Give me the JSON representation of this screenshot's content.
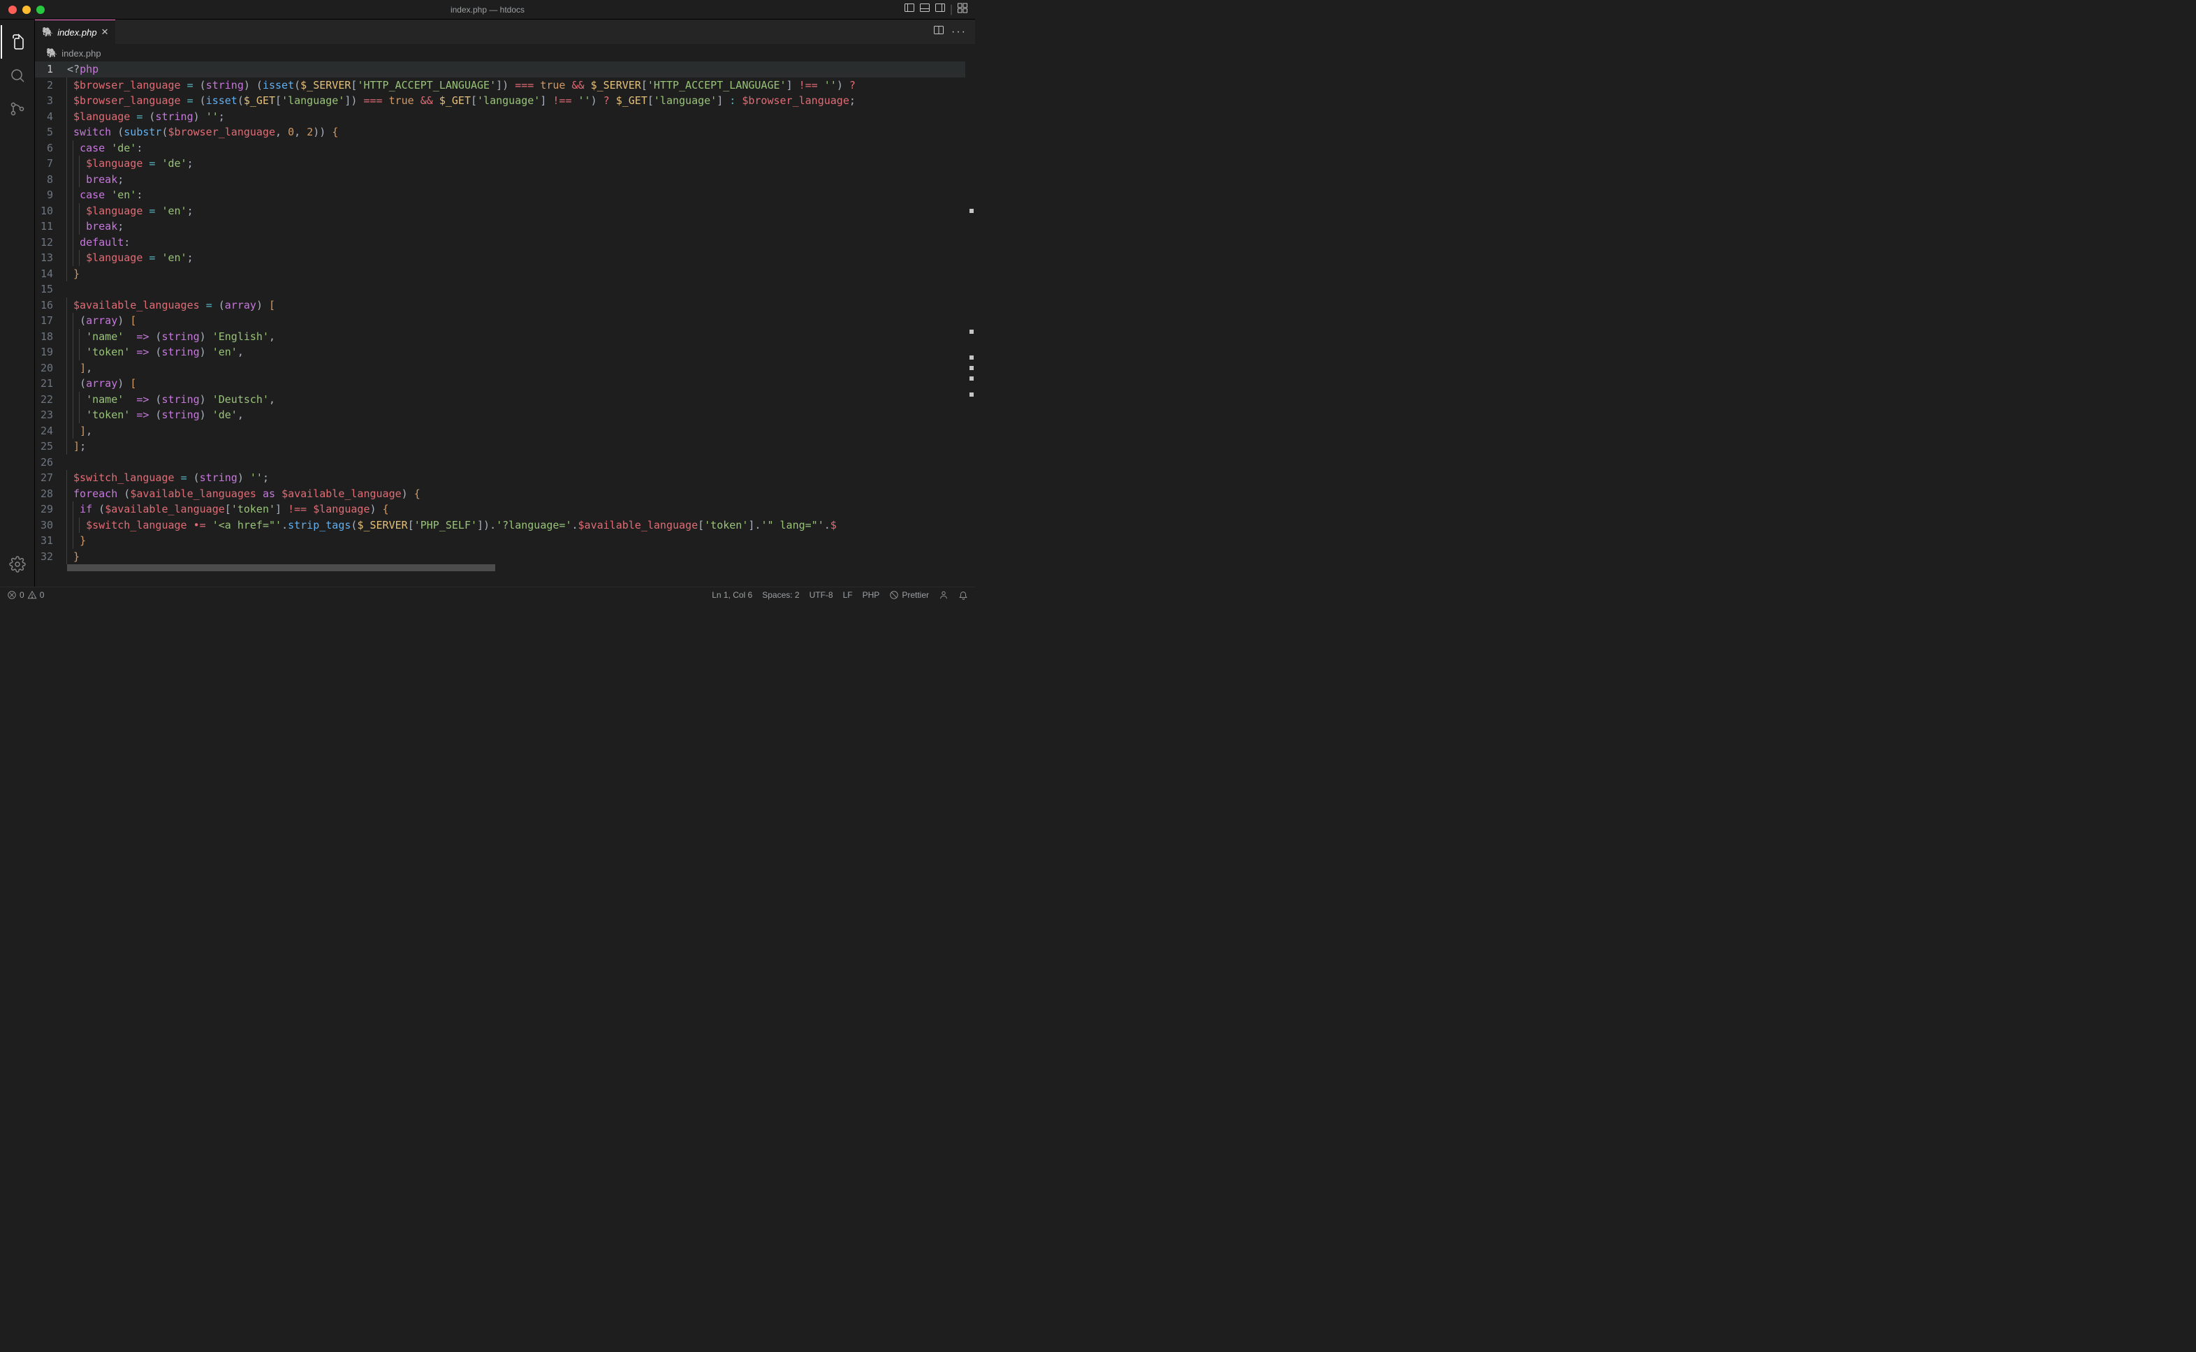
{
  "window": {
    "title": "index.php — htdocs"
  },
  "tab": {
    "label": "index.php"
  },
  "breadcrumb": {
    "label": "index.php"
  },
  "code_lines": [
    {
      "n": 1,
      "active": true,
      "tokens": [
        [
          "p",
          "<?"
        ],
        [
          "k",
          "php"
        ]
      ]
    },
    {
      "n": 2,
      "indent": 1,
      "tokens": [
        [
          "v",
          "$browser_language"
        ],
        [
          "p",
          " "
        ],
        [
          "o",
          "="
        ],
        [
          "p",
          " ("
        ],
        [
          "t",
          "string"
        ],
        [
          "p",
          ") ("
        ],
        [
          "f",
          "isset"
        ],
        [
          "p",
          "("
        ],
        [
          "sv",
          "$_SERVER"
        ],
        [
          "p",
          "["
        ],
        [
          "s",
          "'HTTP_ACCEPT_LANGUAGE'"
        ],
        [
          "p",
          "]) "
        ],
        [
          "eqeq",
          "==="
        ],
        [
          "p",
          " "
        ],
        [
          "n",
          "true"
        ],
        [
          "p",
          " "
        ],
        [
          "op-red",
          "&&"
        ],
        [
          "p",
          " "
        ],
        [
          "sv",
          "$_SERVER"
        ],
        [
          "p",
          "["
        ],
        [
          "s",
          "'HTTP_ACCEPT_LANGUAGE'"
        ],
        [
          "p",
          "] "
        ],
        [
          "eqeq",
          "!=="
        ],
        [
          "p",
          " "
        ],
        [
          "s",
          "''"
        ],
        [
          "p",
          ") "
        ],
        [
          "op-red",
          "?"
        ]
      ]
    },
    {
      "n": 3,
      "indent": 1,
      "tokens": [
        [
          "v",
          "$browser_language"
        ],
        [
          "p",
          " "
        ],
        [
          "o",
          "="
        ],
        [
          "p",
          " ("
        ],
        [
          "f",
          "isset"
        ],
        [
          "p",
          "("
        ],
        [
          "sv",
          "$_GET"
        ],
        [
          "p",
          "["
        ],
        [
          "s",
          "'language'"
        ],
        [
          "p",
          "]) "
        ],
        [
          "eqeq",
          "==="
        ],
        [
          "p",
          " "
        ],
        [
          "n",
          "true"
        ],
        [
          "p",
          " "
        ],
        [
          "op-red",
          "&&"
        ],
        [
          "p",
          " "
        ],
        [
          "sv",
          "$_GET"
        ],
        [
          "p",
          "["
        ],
        [
          "s",
          "'language'"
        ],
        [
          "p",
          "] "
        ],
        [
          "eqeq",
          "!=="
        ],
        [
          "p",
          " "
        ],
        [
          "s",
          "''"
        ],
        [
          "p",
          ") "
        ],
        [
          "op-red",
          "?"
        ],
        [
          "p",
          " "
        ],
        [
          "sv",
          "$_GET"
        ],
        [
          "p",
          "["
        ],
        [
          "s",
          "'language'"
        ],
        [
          "p",
          "] "
        ],
        [
          "o",
          ":"
        ],
        [
          "p",
          " "
        ],
        [
          "v",
          "$browser_language"
        ],
        [
          "p",
          ";"
        ]
      ]
    },
    {
      "n": 4,
      "indent": 1,
      "tokens": [
        [
          "v",
          "$language"
        ],
        [
          "p",
          " "
        ],
        [
          "o",
          "="
        ],
        [
          "p",
          " ("
        ],
        [
          "t",
          "string"
        ],
        [
          "p",
          ") "
        ],
        [
          "s",
          "''"
        ],
        [
          "p",
          ";"
        ]
      ]
    },
    {
      "n": 5,
      "indent": 1,
      "tokens": [
        [
          "k",
          "switch"
        ],
        [
          "p",
          " ("
        ],
        [
          "f",
          "substr"
        ],
        [
          "p",
          "("
        ],
        [
          "v",
          "$browser_language"
        ],
        [
          "p",
          ", "
        ],
        [
          "n",
          "0"
        ],
        [
          "p",
          ", "
        ],
        [
          "n",
          "2"
        ],
        [
          "p",
          ")) "
        ],
        [
          "br",
          "{"
        ]
      ]
    },
    {
      "n": 6,
      "indent": 2,
      "tokens": [
        [
          "k",
          "case"
        ],
        [
          "p",
          " "
        ],
        [
          "s",
          "'de'"
        ],
        [
          "p",
          ":"
        ]
      ]
    },
    {
      "n": 7,
      "indent": 3,
      "tokens": [
        [
          "v",
          "$language"
        ],
        [
          "p",
          " "
        ],
        [
          "o",
          "="
        ],
        [
          "p",
          " "
        ],
        [
          "s",
          "'de'"
        ],
        [
          "p",
          ";"
        ]
      ]
    },
    {
      "n": 8,
      "indent": 3,
      "tokens": [
        [
          "k",
          "break"
        ],
        [
          "p",
          ";"
        ]
      ]
    },
    {
      "n": 9,
      "indent": 2,
      "tokens": [
        [
          "k",
          "case"
        ],
        [
          "p",
          " "
        ],
        [
          "s",
          "'en'"
        ],
        [
          "p",
          ":"
        ]
      ]
    },
    {
      "n": 10,
      "indent": 3,
      "tokens": [
        [
          "v",
          "$language"
        ],
        [
          "p",
          " "
        ],
        [
          "o",
          "="
        ],
        [
          "p",
          " "
        ],
        [
          "s",
          "'en'"
        ],
        [
          "p",
          ";"
        ]
      ]
    },
    {
      "n": 11,
      "indent": 3,
      "tokens": [
        [
          "k",
          "break"
        ],
        [
          "p",
          ";"
        ]
      ]
    },
    {
      "n": 12,
      "indent": 2,
      "tokens": [
        [
          "k",
          "default"
        ],
        [
          "p",
          ":"
        ]
      ]
    },
    {
      "n": 13,
      "indent": 3,
      "tokens": [
        [
          "v",
          "$language"
        ],
        [
          "p",
          " "
        ],
        [
          "o",
          "="
        ],
        [
          "p",
          " "
        ],
        [
          "s",
          "'en'"
        ],
        [
          "p",
          ";"
        ]
      ]
    },
    {
      "n": 14,
      "indent": 1,
      "tokens": [
        [
          "br",
          "}"
        ]
      ]
    },
    {
      "n": 15,
      "indent": 0,
      "tokens": []
    },
    {
      "n": 16,
      "indent": 1,
      "tokens": [
        [
          "v",
          "$available_languages"
        ],
        [
          "p",
          " "
        ],
        [
          "o",
          "="
        ],
        [
          "p",
          " ("
        ],
        [
          "t",
          "array"
        ],
        [
          "p",
          ") "
        ],
        [
          "br",
          "["
        ]
      ]
    },
    {
      "n": 17,
      "indent": 2,
      "tokens": [
        [
          "p",
          "("
        ],
        [
          "t",
          "array"
        ],
        [
          "p",
          ") "
        ],
        [
          "br",
          "["
        ]
      ]
    },
    {
      "n": 18,
      "indent": 3,
      "tokens": [
        [
          "s",
          "'name'"
        ],
        [
          "p",
          "  "
        ],
        [
          "arrow",
          "=>"
        ],
        [
          "p",
          " ("
        ],
        [
          "t",
          "string"
        ],
        [
          "p",
          ") "
        ],
        [
          "s",
          "'English'"
        ],
        [
          "p",
          ","
        ]
      ]
    },
    {
      "n": 19,
      "indent": 3,
      "tokens": [
        [
          "s",
          "'token'"
        ],
        [
          "p",
          " "
        ],
        [
          "arrow",
          "=>"
        ],
        [
          "p",
          " ("
        ],
        [
          "t",
          "string"
        ],
        [
          "p",
          ") "
        ],
        [
          "s",
          "'en'"
        ],
        [
          "p",
          ","
        ]
      ]
    },
    {
      "n": 20,
      "indent": 2,
      "tokens": [
        [
          "br",
          "]"
        ],
        [
          "p",
          ","
        ]
      ]
    },
    {
      "n": 21,
      "indent": 2,
      "tokens": [
        [
          "p",
          "("
        ],
        [
          "t",
          "array"
        ],
        [
          "p",
          ") "
        ],
        [
          "br",
          "["
        ]
      ]
    },
    {
      "n": 22,
      "indent": 3,
      "tokens": [
        [
          "s",
          "'name'"
        ],
        [
          "p",
          "  "
        ],
        [
          "arrow",
          "=>"
        ],
        [
          "p",
          " ("
        ],
        [
          "t",
          "string"
        ],
        [
          "p",
          ") "
        ],
        [
          "s",
          "'Deutsch'"
        ],
        [
          "p",
          ","
        ]
      ]
    },
    {
      "n": 23,
      "indent": 3,
      "tokens": [
        [
          "s",
          "'token'"
        ],
        [
          "p",
          " "
        ],
        [
          "arrow",
          "=>"
        ],
        [
          "p",
          " ("
        ],
        [
          "t",
          "string"
        ],
        [
          "p",
          ") "
        ],
        [
          "s",
          "'de'"
        ],
        [
          "p",
          ","
        ]
      ]
    },
    {
      "n": 24,
      "indent": 2,
      "tokens": [
        [
          "br",
          "]"
        ],
        [
          "p",
          ","
        ]
      ]
    },
    {
      "n": 25,
      "indent": 1,
      "tokens": [
        [
          "br",
          "]"
        ],
        [
          "p",
          ";"
        ]
      ]
    },
    {
      "n": 26,
      "indent": 0,
      "tokens": []
    },
    {
      "n": 27,
      "indent": 1,
      "tokens": [
        [
          "v",
          "$switch_language"
        ],
        [
          "p",
          " "
        ],
        [
          "o",
          "="
        ],
        [
          "p",
          " ("
        ],
        [
          "t",
          "string"
        ],
        [
          "p",
          ") "
        ],
        [
          "s",
          "''"
        ],
        [
          "p",
          ";"
        ]
      ]
    },
    {
      "n": 28,
      "indent": 1,
      "tokens": [
        [
          "k",
          "foreach"
        ],
        [
          "p",
          " ("
        ],
        [
          "v",
          "$available_languages"
        ],
        [
          "p",
          " "
        ],
        [
          "k",
          "as"
        ],
        [
          "p",
          " "
        ],
        [
          "v",
          "$available_language"
        ],
        [
          "p",
          ") "
        ],
        [
          "br",
          "{"
        ]
      ]
    },
    {
      "n": 29,
      "indent": 2,
      "tokens": [
        [
          "k",
          "if"
        ],
        [
          "p",
          " ("
        ],
        [
          "v",
          "$available_language"
        ],
        [
          "p",
          "["
        ],
        [
          "s",
          "'token'"
        ],
        [
          "p",
          "] "
        ],
        [
          "eqeq",
          "!=="
        ],
        [
          "p",
          " "
        ],
        [
          "v",
          "$language"
        ],
        [
          "p",
          ") "
        ],
        [
          "br",
          "{"
        ]
      ]
    },
    {
      "n": 30,
      "indent": 3,
      "tokens": [
        [
          "v",
          "$switch_language"
        ],
        [
          "p",
          " "
        ],
        [
          "op-red",
          "•="
        ],
        [
          "p",
          " "
        ],
        [
          "s",
          "'<a href=\"'"
        ],
        [
          "p",
          "."
        ],
        [
          "f",
          "strip_tags"
        ],
        [
          "p",
          "("
        ],
        [
          "sv",
          "$_SERVER"
        ],
        [
          "p",
          "["
        ],
        [
          "s",
          "'PHP_SELF'"
        ],
        [
          "p",
          "])."
        ],
        [
          "s",
          "'?language='"
        ],
        [
          "p",
          "."
        ],
        [
          "v",
          "$available_language"
        ],
        [
          "p",
          "["
        ],
        [
          "s",
          "'token'"
        ],
        [
          "p",
          "]."
        ],
        [
          "s",
          "'\" lang=\"'"
        ],
        [
          "p",
          "."
        ],
        [
          "v",
          "$"
        ]
      ]
    },
    {
      "n": 31,
      "indent": 2,
      "tokens": [
        [
          "br",
          "}"
        ]
      ]
    },
    {
      "n": 32,
      "indent": 1,
      "tokens": [
        [
          "br",
          "}"
        ]
      ]
    }
  ],
  "status": {
    "errors": "0",
    "warnings": "0",
    "ln_col": "Ln 1, Col 6",
    "spaces": "Spaces: 2",
    "encoding": "UTF-8",
    "eol": "LF",
    "language": "PHP",
    "prettier": "Prettier"
  },
  "minimap_marks": [
    28,
    51,
    56,
    58,
    60,
    63
  ]
}
